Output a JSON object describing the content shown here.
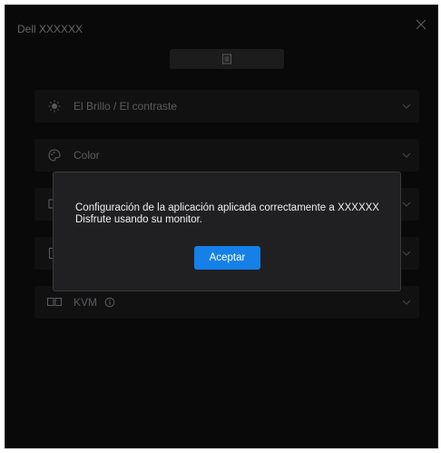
{
  "window": {
    "title": "Dell XXXXXX"
  },
  "panels": [
    {
      "label": "El Brillo / El contraste",
      "icon": "brightness-icon"
    },
    {
      "label": "Color",
      "icon": "color-palette-icon"
    },
    {
      "label": "",
      "icon": "input-icon"
    },
    {
      "label": "",
      "icon": "display-icon"
    },
    {
      "label": "KVM",
      "icon": "kvm-icon"
    }
  ],
  "dialog": {
    "line1": "Configuración de la aplicación aplicada correctamente a XXXXXX",
    "line2": "Disfrute usando su monitor.",
    "accept_label": "Aceptar"
  },
  "colors": {
    "accent": "#1580e8",
    "background": "#0f0f10",
    "panel": "#1b1b1d",
    "dialog": "#202022"
  }
}
